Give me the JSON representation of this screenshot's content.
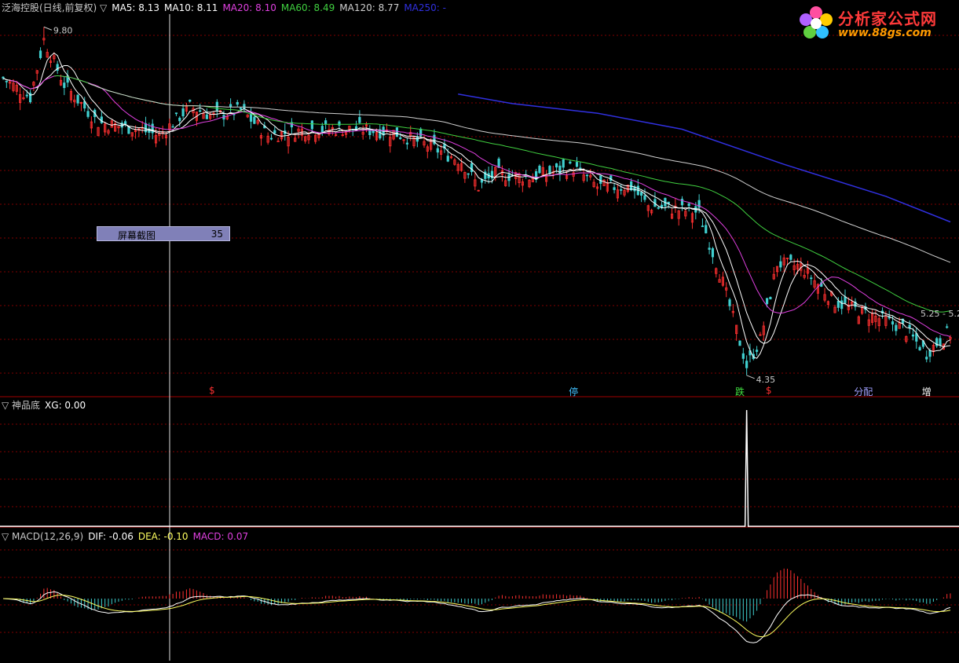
{
  "legends": {
    "main": [
      {
        "text": "泛海控股(日线,前复权) ▽",
        "color": "#c8c8c8"
      },
      {
        "text": "MA5: 8.13",
        "color": "#ffffff"
      },
      {
        "text": "MA10: 8.11",
        "color": "#ffffff"
      },
      {
        "text": "MA20: 8.10",
        "color": "#e040e0"
      },
      {
        "text": "MA60: 8.49",
        "color": "#40d040"
      },
      {
        "text": "MA120: 8.77",
        "color": "#d0d0d0"
      },
      {
        "text": "MA250: -",
        "color": "#3030e0"
      }
    ],
    "xg": [
      {
        "text": "▽ 神品底",
        "color": "#c8c8c8"
      },
      {
        "text": "XG: 0.00",
        "color": "#ffffff"
      }
    ],
    "macd": [
      {
        "text": "▽ MACD(12,26,9)",
        "color": "#c8c8c8"
      },
      {
        "text": "DIF: -0.06",
        "color": "#ffffff"
      },
      {
        "text": "DEA: -0.10",
        "color": "#ffff60"
      },
      {
        "text": "MACD: 0.07",
        "color": "#e040e0"
      }
    ]
  },
  "logo": {
    "brand": "分析家公式网",
    "site": "www.88gs.com"
  },
  "popup": {
    "label": "屏幕截图",
    "value": "35"
  },
  "annotations": {
    "high": "9.80",
    "low": "4.35",
    "last_range": "5.25 - 5.2"
  },
  "signals": [
    {
      "text": "$",
      "color": "#ff3030",
      "index": 62
    },
    {
      "text": "停",
      "color": "#40c0ff",
      "index": 168
    },
    {
      "text": "跌",
      "color": "#40e040",
      "index": 217
    },
    {
      "text": "$",
      "color": "#ff3030",
      "index": 226
    },
    {
      "text": "分配",
      "color": "#a0a0ff",
      "index": 252
    },
    {
      "text": "增",
      "color": "#ffffff",
      "index": 272
    }
  ],
  "colors": {
    "up": "#ff3030",
    "down": "#40d0d0",
    "grid": "#800000",
    "axis": "#a00000"
  },
  "chart_data": {
    "type": "line",
    "price_key_points": [
      [
        0,
        9.0
      ],
      [
        8,
        8.7
      ],
      [
        12,
        9.6
      ],
      [
        18,
        8.9
      ],
      [
        28,
        8.3
      ],
      [
        40,
        8.2
      ],
      [
        46,
        8.1
      ],
      [
        55,
        8.55
      ],
      [
        62,
        8.4
      ],
      [
        70,
        8.5
      ],
      [
        78,
        8.1
      ],
      [
        90,
        8.2
      ],
      [
        105,
        8.2
      ],
      [
        115,
        8.15
      ],
      [
        125,
        7.95
      ],
      [
        135,
        7.7
      ],
      [
        140,
        7.3
      ],
      [
        145,
        7.5
      ],
      [
        155,
        7.45
      ],
      [
        168,
        7.6
      ],
      [
        175,
        7.3
      ],
      [
        185,
        7.3
      ],
      [
        190,
        7.0
      ],
      [
        205,
        6.9
      ],
      [
        212,
        5.8
      ],
      [
        219,
        4.5
      ],
      [
        223,
        4.9
      ],
      [
        228,
        6.1
      ],
      [
        235,
        6.05
      ],
      [
        245,
        5.5
      ],
      [
        255,
        5.3
      ],
      [
        265,
        5.1
      ],
      [
        272,
        4.7
      ],
      [
        278,
        5.0
      ]
    ],
    "count": 280,
    "ylim_main": [
      4.2,
      10.0
    ],
    "high_label_at": 12,
    "low_label_at": 219,
    "xg_spike_at": 219,
    "ma250": [
      [
        134,
        8.75
      ],
      [
        150,
        8.6
      ],
      [
        175,
        8.45
      ],
      [
        200,
        8.2
      ],
      [
        230,
        7.65
      ],
      [
        260,
        7.15
      ],
      [
        279,
        6.75
      ]
    ]
  }
}
